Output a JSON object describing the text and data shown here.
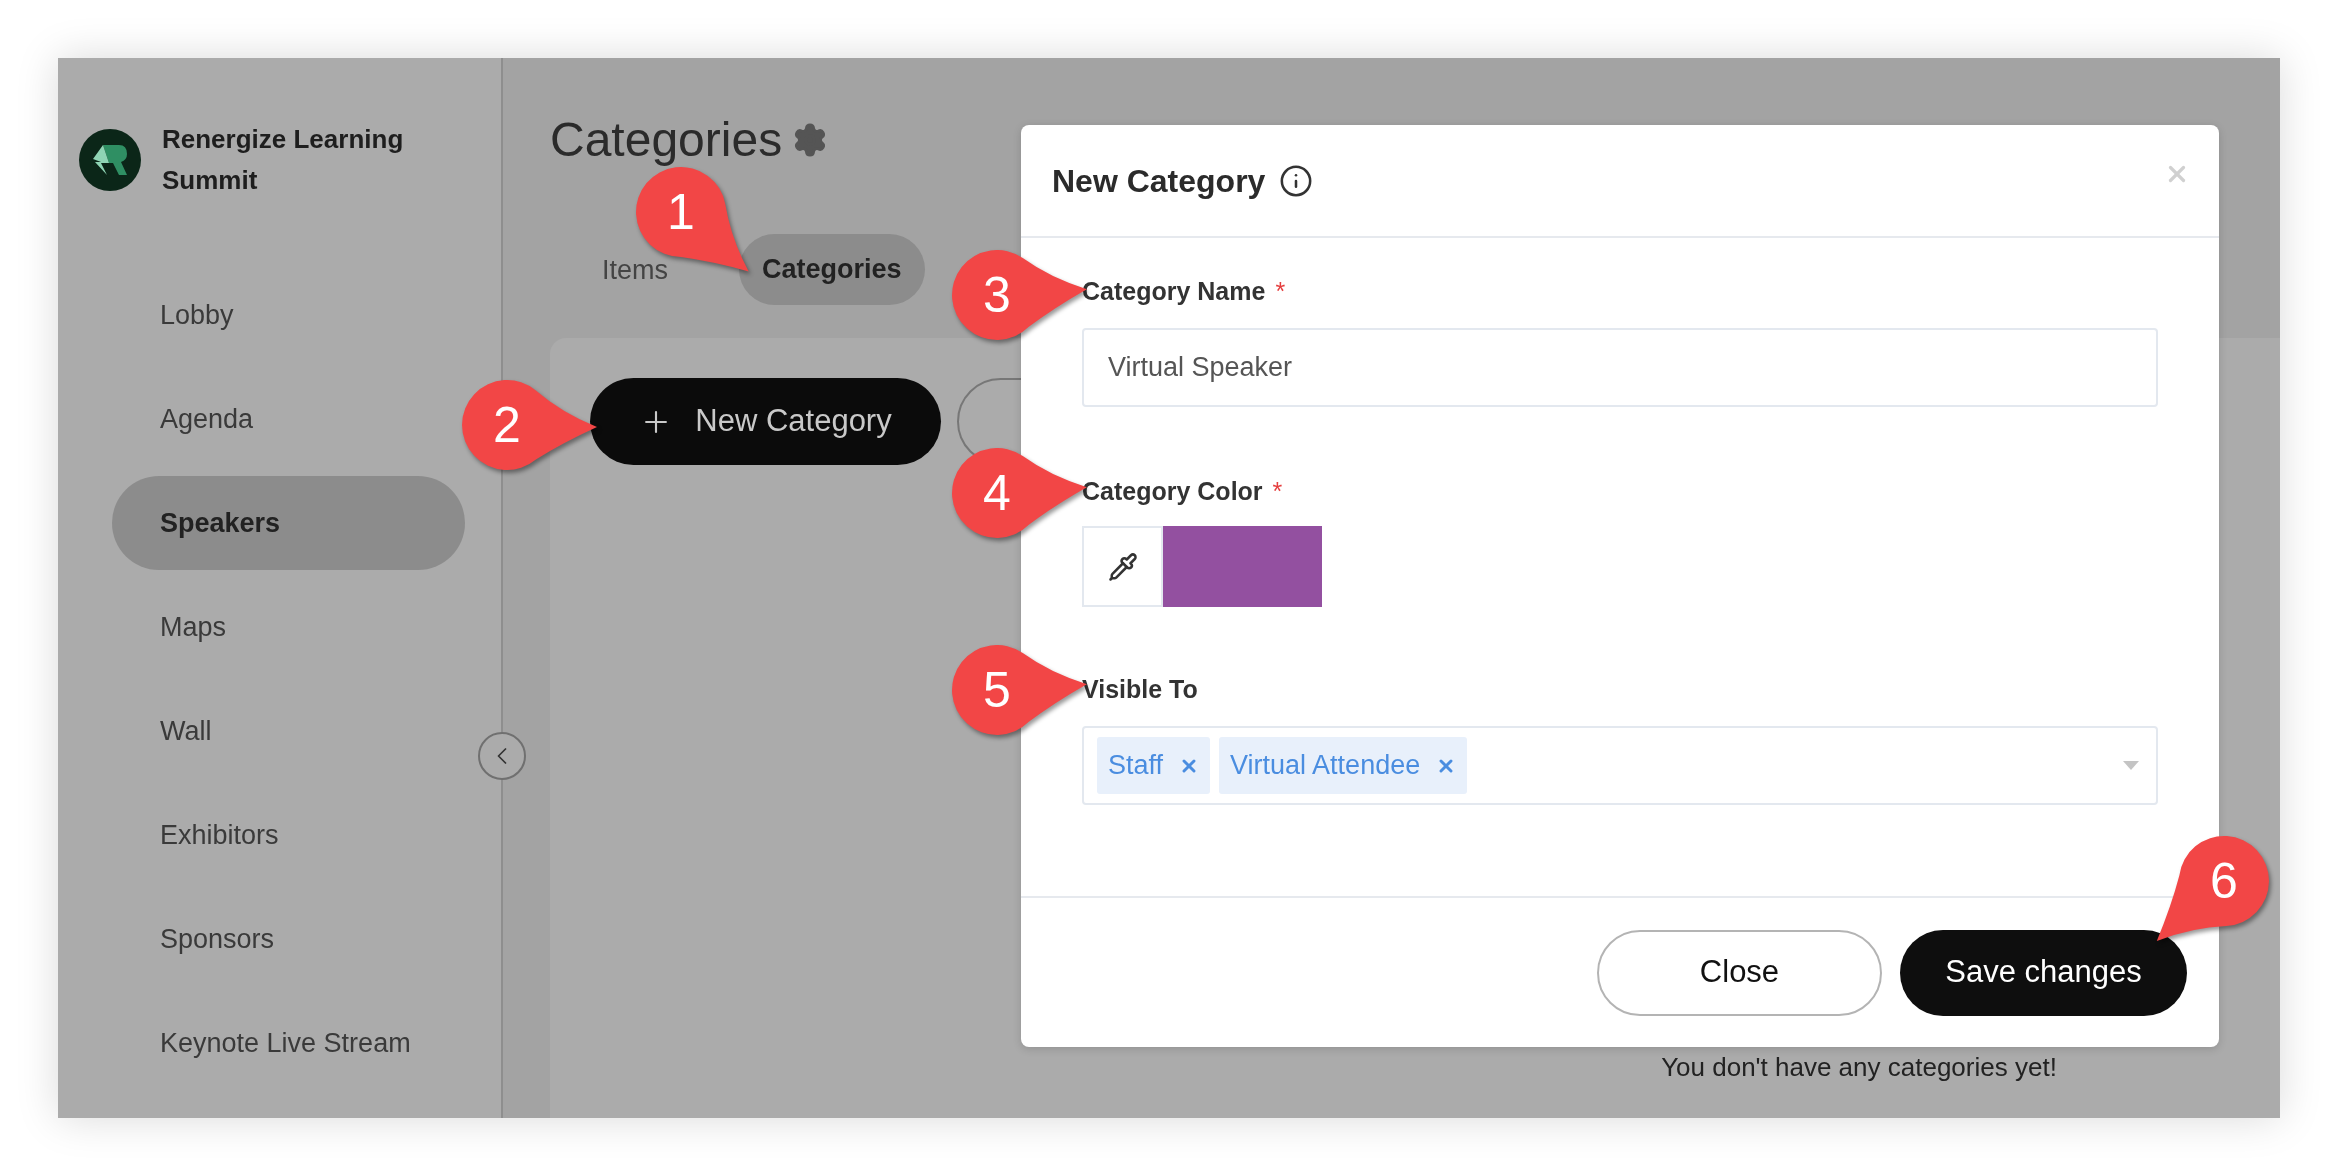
{
  "sidebar": {
    "brand": "Renergize Learning Summit",
    "items": [
      {
        "label": "Lobby",
        "selected": false
      },
      {
        "label": "Agenda",
        "selected": false
      },
      {
        "label": "Speakers",
        "selected": true
      },
      {
        "label": "Maps",
        "selected": false
      },
      {
        "label": "Wall",
        "selected": false
      },
      {
        "label": "Exhibitors",
        "selected": false
      },
      {
        "label": "Sponsors",
        "selected": false
      },
      {
        "label": "Keynote Live Stream",
        "selected": false
      }
    ]
  },
  "page": {
    "title": "Categories",
    "tabs": [
      {
        "label": "Items",
        "selected": false
      },
      {
        "label": "Categories",
        "selected": true
      }
    ],
    "new_button": "New Category",
    "empty_message": "You don't have any categories yet!"
  },
  "modal": {
    "title": "New Category",
    "fields": [
      {
        "kind": "text",
        "label": "Category Name",
        "required_mark": "*",
        "value": "Virtual Speaker"
      },
      {
        "kind": "color",
        "label": "Category Color",
        "required_mark": "*",
        "color": "#9350a0"
      },
      {
        "kind": "tags",
        "label": "Visible To",
        "tags": [
          "Staff",
          "Virtual Attendee"
        ]
      }
    ],
    "buttons": [
      {
        "label": "Close",
        "kind": "secondary"
      },
      {
        "label": "Save changes",
        "kind": "primary"
      }
    ]
  },
  "callouts": [
    "1",
    "2",
    "3",
    "4",
    "5",
    "6"
  ]
}
